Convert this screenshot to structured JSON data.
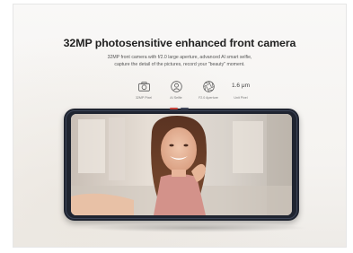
{
  "headline": "32MP photosensitive enhanced front camera",
  "description": {
    "line1": "32MP front camera with f/2.0 large aperture, advanced AI smart selfie,",
    "line2": "capture the detail of the pictures, record your \"beauty\" moment."
  },
  "features": [
    {
      "icon": "camera-icon",
      "label": "32MP Pixel"
    },
    {
      "icon": "ai-selfie-icon",
      "label": "AI Selfie"
    },
    {
      "icon": "aperture-icon",
      "label": "F2.0 Aperture"
    },
    {
      "big": "1.6 μm",
      "label": "Unit Pixel"
    }
  ],
  "colors": {
    "background": "#f7f6f4",
    "phone_body": "#1f2430",
    "button_accent": "#c9433a",
    "title_text": "#222222"
  }
}
